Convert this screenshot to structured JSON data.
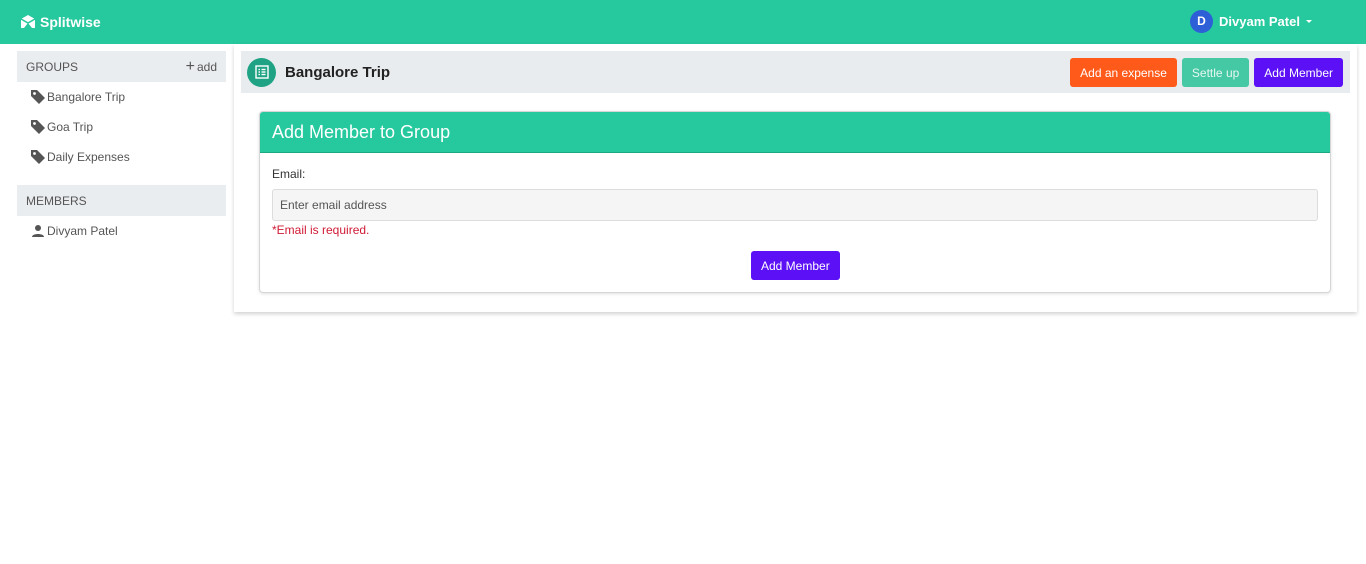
{
  "navbar": {
    "brand": "Splitwise",
    "user_initial": "D",
    "user_name": "Divyam Patel"
  },
  "sidebar": {
    "groups_header": "GROUPS",
    "add_label": "add",
    "groups": [
      {
        "label": "Bangalore Trip"
      },
      {
        "label": "Goa Trip"
      },
      {
        "label": "Daily Expenses"
      }
    ],
    "members_header": "MEMBERS",
    "members": [
      {
        "label": "Divyam Patel"
      }
    ]
  },
  "group": {
    "title": "Bangalore Trip",
    "add_expense_label": "Add an expense",
    "settle_up_label": "Settle up",
    "add_member_label": "Add Member"
  },
  "form": {
    "title": "Add Member to Group",
    "email_label": "Email:",
    "email_placeholder": "Enter email address",
    "email_value": "",
    "error_text": "*Email is required.",
    "submit_label": "Add Member"
  },
  "colors": {
    "brand_green": "#26c89e",
    "expense_orange": "#ff5a19",
    "member_purple": "#5b10f5",
    "error_red": "#d01a34"
  }
}
